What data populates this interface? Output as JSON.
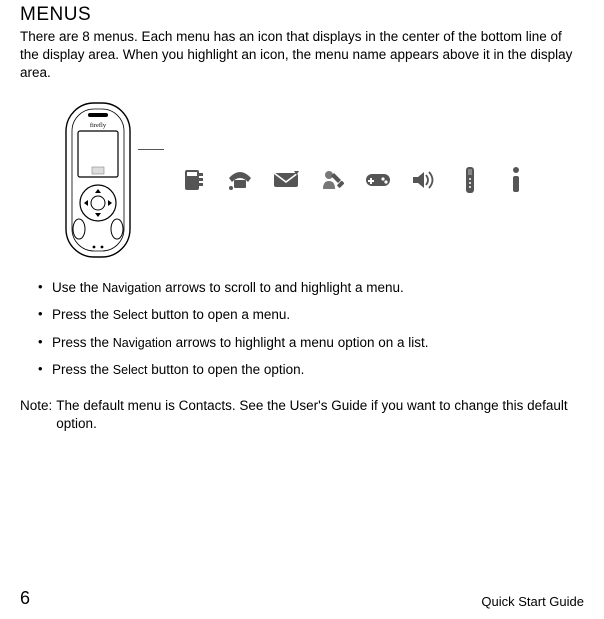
{
  "heading": "MENUS",
  "intro": "There are 8 menus. Each menu has an icon that displays in the center of the bottom line of the display area. When you highlight an icon, the menu name appears above it in the display area.",
  "phone_brand": "firefly",
  "menu_icons": [
    "contacts-icon",
    "calls-icon",
    "messages-icon",
    "settings-icon",
    "games-icon",
    "sounds-icon",
    "tools-icon",
    "info-icon"
  ],
  "bullets": [
    {
      "pre": "Use the ",
      "btn": "Navigation",
      "post": " arrows to scroll to and highlight a menu."
    },
    {
      "pre": "Press the ",
      "btn": "Select",
      "post": " button to open a menu."
    },
    {
      "pre": "Press the ",
      "btn": "Navigation",
      "post": " arrows to highlight a menu option on a list."
    },
    {
      "pre": "Press the ",
      "btn": "Select",
      "post": " button to open the option."
    }
  ],
  "note_label": "Note:",
  "note_body": "The default menu is Contacts. See the User's Guide if you want to change this default option.",
  "page_number": "6",
  "footer_text": "Quick Start Guide"
}
